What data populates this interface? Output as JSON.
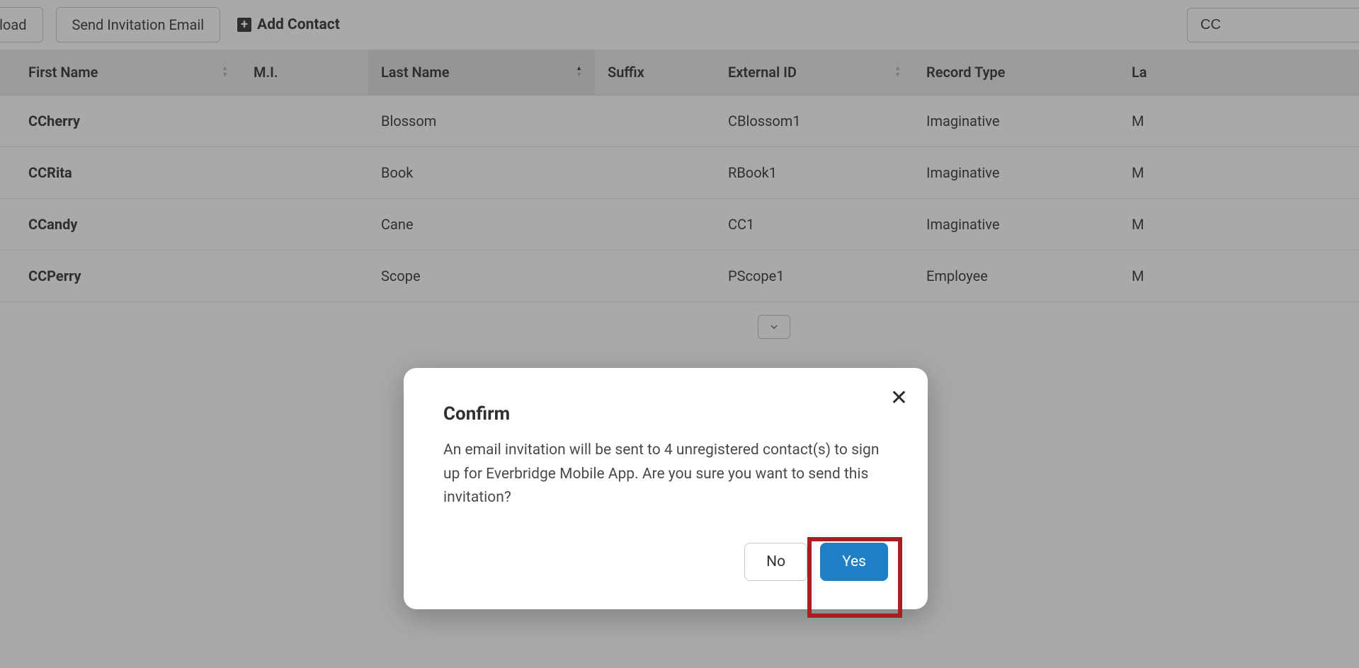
{
  "toolbar": {
    "download_label": "wnload",
    "send_invitation_label": "Send Invitation Email",
    "add_contact_label": "Add Contact",
    "search_value": "CC"
  },
  "columns": {
    "first_name": "First Name",
    "mi": "M.I.",
    "last_name": "Last Name",
    "suffix": "Suffix",
    "external_id": "External ID",
    "record_type": "Record Type",
    "last_col": "La"
  },
  "rows": [
    {
      "first_name": "CCherry",
      "mi": "",
      "last_name": "Blossom",
      "suffix": "",
      "external_id": "CBlossom1",
      "record_type": "Imaginative",
      "last": "M"
    },
    {
      "first_name": "CCRita",
      "mi": "",
      "last_name": "Book",
      "suffix": "",
      "external_id": "RBook1",
      "record_type": "Imaginative",
      "last": "M"
    },
    {
      "first_name": "CCandy",
      "mi": "",
      "last_name": "Cane",
      "suffix": "",
      "external_id": "CC1",
      "record_type": "Imaginative",
      "last": "M"
    },
    {
      "first_name": "CCPerry",
      "mi": "",
      "last_name": "Scope",
      "suffix": "",
      "external_id": "PScope1",
      "record_type": "Employee",
      "last": "M"
    }
  ],
  "modal": {
    "title": "Confirm",
    "body": "An email invitation will be sent to 4 unregistered contact(s) to sign up for Everbridge Mobile App. Are you sure you want to send this invitation?",
    "no_label": "No",
    "yes_label": "Yes"
  }
}
